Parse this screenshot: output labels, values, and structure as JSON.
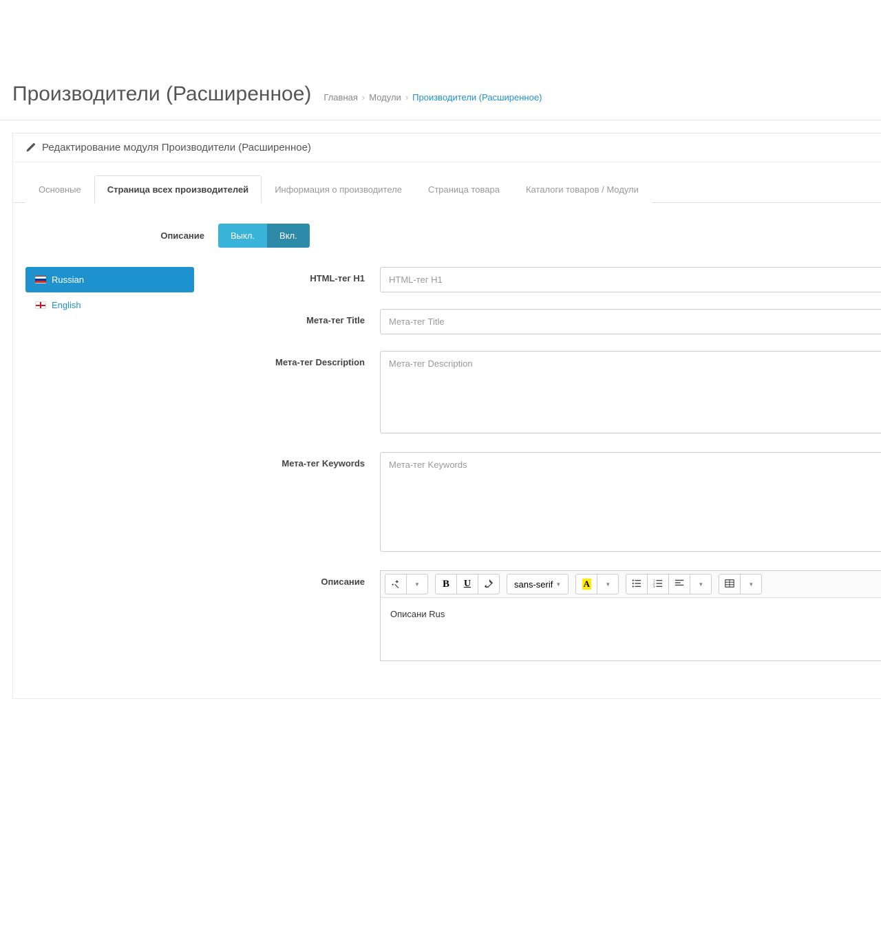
{
  "header": {
    "title": "Производители (Расширенное)",
    "breadcrumb": {
      "home": "Главная",
      "modules": "Модули",
      "current": "Производители (Расширенное)"
    }
  },
  "panel": {
    "heading": "Редактирование модуля Производители (Расширенное)"
  },
  "tabs": {
    "t0": "Основные",
    "t1": "Страница всех производителей",
    "t2": "Информация о производителе",
    "t3": "Страница товара",
    "t4": "Каталоги товаров / Модули"
  },
  "toggle": {
    "label": "Описание",
    "off": "Выкл.",
    "on": "Вкл."
  },
  "langs": {
    "ru": "Russian",
    "en": "English"
  },
  "form": {
    "h1_label": "HTML-тег H1",
    "h1_ph": "HTML-тег H1",
    "title_label": "Мета-тег Title",
    "title_ph": "Мета-тег Title",
    "desc_label": "Мета-тег Description",
    "desc_ph": "Мета-тег Description",
    "kw_label": "Мета-тег Keywords",
    "kw_ph": "Мета-тег Keywords",
    "editor_label": "Описание"
  },
  "editor": {
    "font_family": "sans-serif",
    "color_swatch": "A",
    "content": "Описани Rus"
  }
}
